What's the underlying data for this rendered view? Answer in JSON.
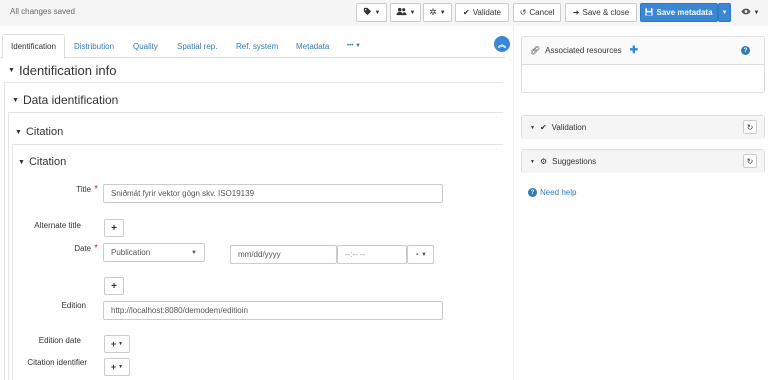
{
  "topbar": {
    "status": "All changes saved",
    "tag_icon": "tag-icon",
    "users_icon": "users-icon",
    "settings_icon": "gear-icon",
    "validate_label": "Validate",
    "cancel_label": "Cancel",
    "save_close_label": "Save & close",
    "save_metadata_label": "Save metadata",
    "view_icon": "eye-icon"
  },
  "tabs": [
    {
      "label": "Identification"
    },
    {
      "label": "Distribution"
    },
    {
      "label": "Quality"
    },
    {
      "label": "Spatial rep."
    },
    {
      "label": "Ref. system"
    },
    {
      "label": "Metadata"
    },
    {
      "label": "•••"
    }
  ],
  "sections": {
    "identification_info": "Identification info",
    "data_identification": "Data identification",
    "citation_outer": "Citation",
    "citation_inner": "Citation"
  },
  "form": {
    "title_label": "Title",
    "title_value": "Sniðmát fyrir vektor gögn skv. ISO19139",
    "alternate_title_label": "Alternate title",
    "date_label": "Date",
    "date_type_value": "Publication",
    "date_placeholder": "mm/dd/yyyy",
    "time_placeholder": "--:-- --",
    "edition_label": "Edition",
    "edition_value": "http://localhost:8080/demodem/editioin",
    "edition_date_label": "Edition date",
    "citation_identifier_label": "Citation identifier"
  },
  "panels": {
    "associated_resources": "Associated resources",
    "validation": "Validation",
    "suggestions": "Suggestions",
    "need_help": "Need help"
  },
  "colors": {
    "primary": "#3a87d6",
    "link": "#337ab7",
    "required": "#c9302c"
  }
}
